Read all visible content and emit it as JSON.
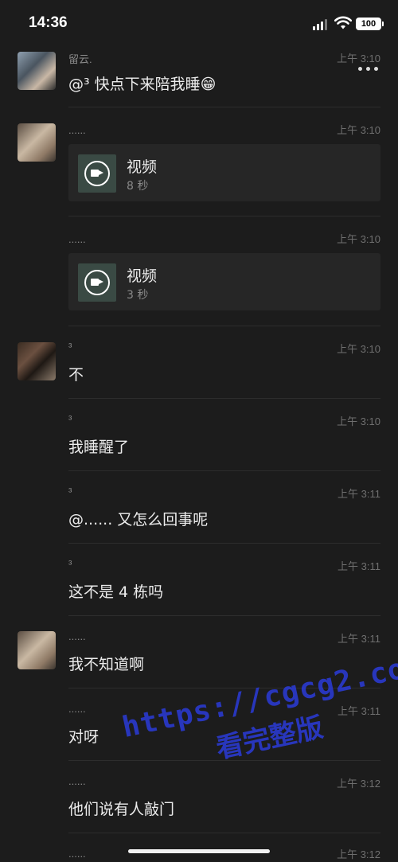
{
  "status_bar": {
    "time": "14:36",
    "battery": "100"
  },
  "messages": [
    {
      "name": "留云.",
      "time": "上午 3:10",
      "text": "@³ 快点下来陪我睡😁"
    },
    {
      "name": "......",
      "time": "上午 3:10",
      "video": {
        "title": "视频",
        "duration": "8 秒"
      }
    },
    {
      "name": "......",
      "time": "上午 3:10",
      "video": {
        "title": "视频",
        "duration": "3 秒"
      }
    },
    {
      "name": "³",
      "time": "上午 3:10",
      "text": "不"
    },
    {
      "name": "³",
      "time": "上午 3:10",
      "text": "我睡醒了"
    },
    {
      "name": "³",
      "time": "上午 3:11",
      "text": "@...... 又怎么回事呢"
    },
    {
      "name": "³",
      "time": "上午 3:11",
      "text": "这不是 4 栋吗"
    },
    {
      "name": "......",
      "time": "上午 3:11",
      "text": "我不知道啊"
    },
    {
      "name": "......",
      "time": "上午 3:11",
      "text": "对呀"
    },
    {
      "name": "......",
      "time": "上午 3:12",
      "text": "他们说有人敲门"
    },
    {
      "name": "......",
      "time": "上午 3:12"
    }
  ],
  "watermark": {
    "line1": "https://cgcg2.co",
    "line2": "看完整版"
  },
  "icons": {
    "more": "more-icon",
    "video": "video-camera-icon",
    "signal": "signal-icon",
    "wifi": "wifi-icon",
    "battery": "battery-icon"
  }
}
